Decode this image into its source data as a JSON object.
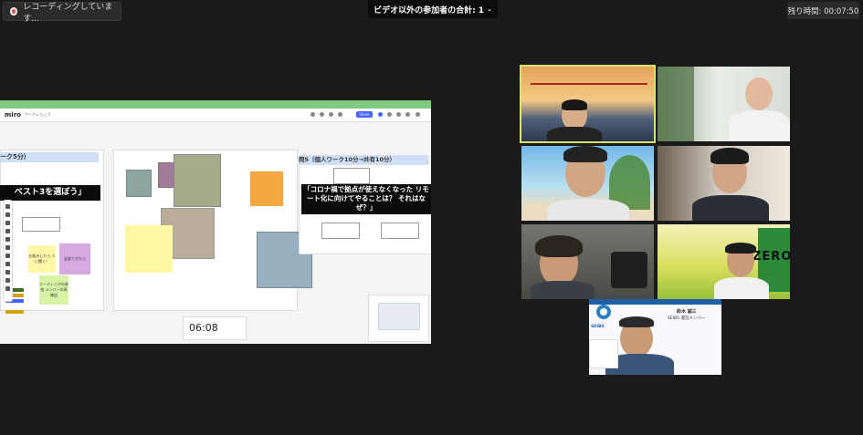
{
  "topbar": {
    "recording_label": "レコーディングしています...",
    "participants_label": "ビデオ以外の参加者の合計: 1",
    "remaining_label": "残り時間: 00:07:50"
  },
  "miro": {
    "logo": "miro",
    "board_title": "ワークショップ",
    "share_label": "Share",
    "frame_left_title": "ーク5分）",
    "left_heading": "ベスト3を選ぼう」",
    "right_title": "問5（個人ワーク10分→共有10分）",
    "right_question": "「コロナ禍で拠点が使えなくなった リモート化に向けてやることは？ それはなぜ？」",
    "sticky_left_1": "仕組みしたら 人に聞く！",
    "sticky_left_2": "全部できたら",
    "sticky_left_3": "ミーティングの参加 メンバーの再確認",
    "timer_value": "06:08"
  },
  "slide": {
    "logo_text": "SEIBS",
    "name": "鈴木 誠三",
    "role": "SEIBS 運営メンバー"
  },
  "colors": {
    "active_speaker_border": "#d6e36f",
    "miro_banner": "#7fc97f",
    "recording_dot": "#d9534f"
  }
}
